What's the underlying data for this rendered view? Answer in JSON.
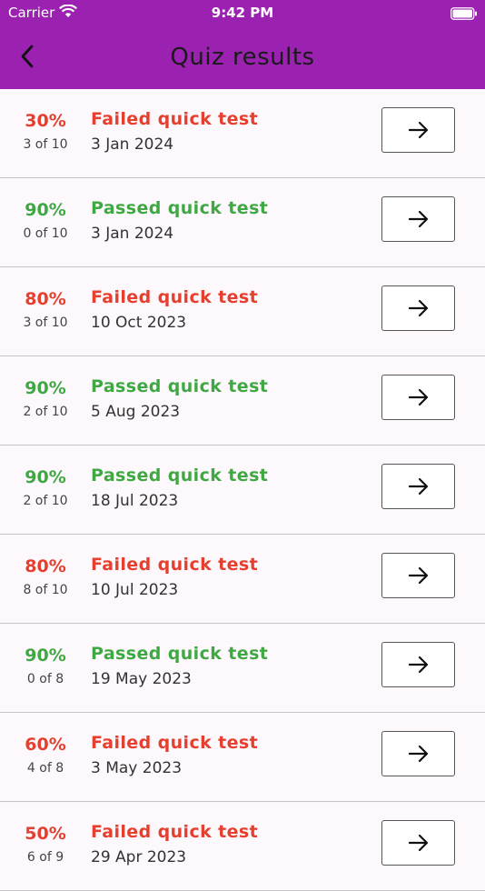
{
  "status_bar": {
    "carrier": "Carrier",
    "time": "9:42 PM"
  },
  "header": {
    "title": "Quiz results",
    "back_icon": "chevron-left-icon"
  },
  "colors": {
    "header_bg": "#9b22b0",
    "failed": "#e5402f",
    "passed": "#40a843"
  },
  "results": [
    {
      "score": "30%",
      "count": "3 of 10",
      "status": "Failed quick test",
      "date": "3 Jan 2024",
      "passed": false
    },
    {
      "score": "90%",
      "count": "0 of 10",
      "status": "Passed quick test",
      "date": "3 Jan 2024",
      "passed": true
    },
    {
      "score": "80%",
      "count": "3 of 10",
      "status": "Failed quick test",
      "date": "10 Oct 2023",
      "passed": false
    },
    {
      "score": "90%",
      "count": "2 of 10",
      "status": "Passed quick test",
      "date": "5 Aug 2023",
      "passed": true
    },
    {
      "score": "90%",
      "count": "2 of 10",
      "status": "Passed quick test",
      "date": "18 Jul 2023",
      "passed": true
    },
    {
      "score": "80%",
      "count": "8 of 10",
      "status": "Failed quick test",
      "date": "10 Jul 2023",
      "passed": false
    },
    {
      "score": "90%",
      "count": "0 of 8",
      "status": "Passed quick test",
      "date": "19 May 2023",
      "passed": true
    },
    {
      "score": "60%",
      "count": "4 of 8",
      "status": "Failed quick test",
      "date": "3 May 2023",
      "passed": false
    },
    {
      "score": "50%",
      "count": "6 of 9",
      "status": "Failed quick test",
      "date": "29 Apr 2023",
      "passed": false
    }
  ]
}
